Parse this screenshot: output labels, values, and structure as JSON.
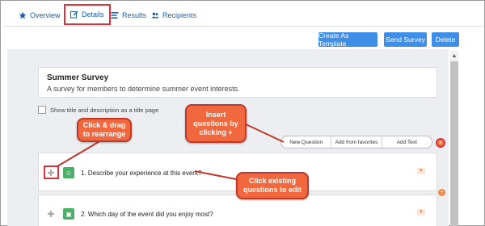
{
  "tabs": [
    {
      "label": "Overview",
      "icon": "star-icon"
    },
    {
      "label": "Details",
      "icon": "edit-icon"
    },
    {
      "label": "Results",
      "icon": "list-icon"
    },
    {
      "label": "Recipients",
      "icon": "users-icon"
    }
  ],
  "toolbar": {
    "create_template_label": "Create As Template",
    "send_survey_label": "Send Survey",
    "delete_label": "Delete"
  },
  "survey": {
    "title": "Summer Survey",
    "description": "A survey for members to determine summer event interests."
  },
  "show_title_label": "Show title and description as a title page",
  "insert_bar": {
    "new_question": "New Question",
    "add_favorites": "Add from favorites",
    "add_text": "Add Text"
  },
  "questions": [
    {
      "text": "1. Describe your experience at this event?",
      "icon": "smiley-icon"
    },
    {
      "text": "2. Which day of the event did you enjoy most?",
      "icon": "calendar-icon"
    }
  ],
  "callouts": {
    "insert": "Insert questions by clicking +",
    "drag": "Click & drag to rearrange",
    "edit": "Click existing questions to edit"
  },
  "colors": {
    "accent": "#3f8ee8",
    "callout": "#f2683e",
    "highlight": "#e0303a",
    "question_icon": "#4caf6a"
  }
}
